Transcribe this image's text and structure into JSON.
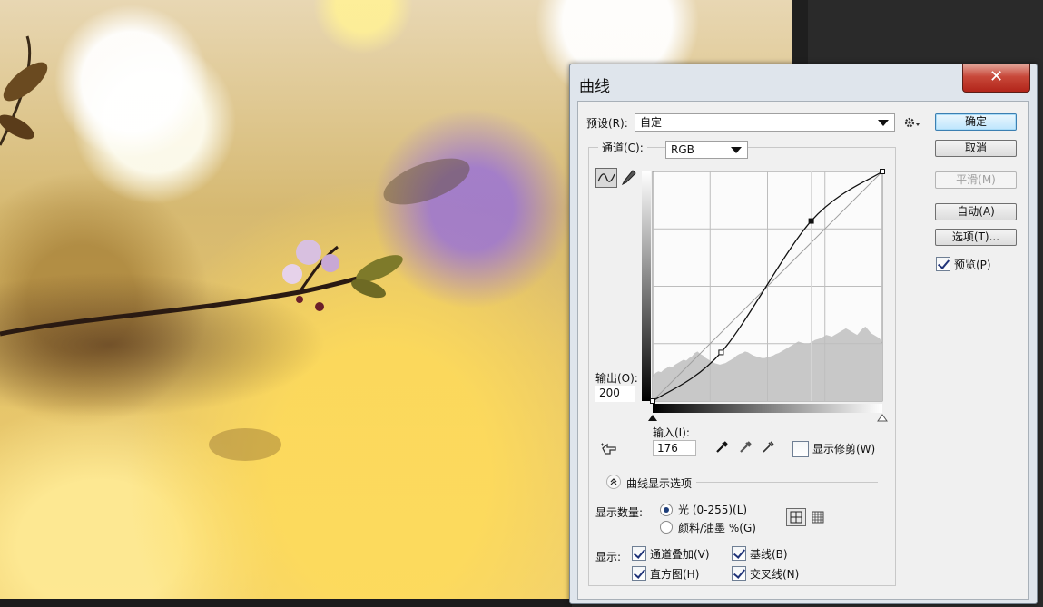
{
  "dialog": {
    "title": "曲线",
    "close_glyph": "✕"
  },
  "preset": {
    "label": "预设(R):",
    "value": "自定"
  },
  "channel": {
    "label": "通道(C):",
    "value": "RGB"
  },
  "buttons": {
    "ok": "确定",
    "cancel": "取消",
    "smooth": "平滑(M)",
    "auto": "自动(A)",
    "options": "选项(T)...",
    "preview": "预览(P)"
  },
  "output": {
    "label": "输出(O):",
    "value": "200"
  },
  "input": {
    "label": "输入(I):",
    "value": "176"
  },
  "show_clipping": "显示修剪(W)",
  "curve_display_options": "曲线显示选项",
  "show_amount": {
    "label": "显示数量:",
    "light": "光 (0-255)(L)",
    "pigment": "颜料/油墨 %(G)",
    "selected": "light"
  },
  "show": {
    "label": "显示:",
    "channel_overlays": "通道叠加(V)",
    "baseline": "基线(B)",
    "histogram": "直方图(H)",
    "intersection": "交叉线(N)"
  },
  "icons": {
    "settings": "gear-icon",
    "curve_tool": "curve-point-icon",
    "pencil_tool": "pencil-icon",
    "target_adjust": "hand-target-icon",
    "black_eyedropper": "eyedropper-icon",
    "gray_eyedropper": "eyedropper-icon",
    "white_eyedropper": "eyedropper-icon",
    "collapse": "chevron-up-icon"
  },
  "chart_data": {
    "type": "line",
    "title": "",
    "xlabel": "",
    "ylabel": "",
    "xlim": [
      0,
      255
    ],
    "ylim": [
      0,
      255
    ],
    "grid": true,
    "curve_points": [
      [
        0,
        0
      ],
      [
        76,
        54
      ],
      [
        176,
        200
      ],
      [
        255,
        255
      ]
    ],
    "histogram": [
      30,
      34,
      36,
      35,
      38,
      40,
      42,
      41,
      44,
      46,
      48,
      50,
      49,
      52,
      54,
      58,
      60,
      57,
      55,
      52,
      50,
      48,
      46,
      45,
      44,
      45,
      46,
      48,
      50,
      52,
      55,
      57,
      58,
      60,
      59,
      57,
      55,
      54,
      53,
      52,
      52,
      53,
      54,
      55,
      57,
      58,
      60,
      62,
      64,
      66,
      68,
      70,
      72,
      71,
      70,
      69,
      70,
      72,
      74,
      75,
      76,
      78,
      80,
      79,
      78,
      80,
      82,
      84,
      86,
      88,
      86,
      84,
      82,
      80,
      84,
      88,
      90,
      86,
      82,
      80,
      78,
      76,
      70
    ]
  }
}
